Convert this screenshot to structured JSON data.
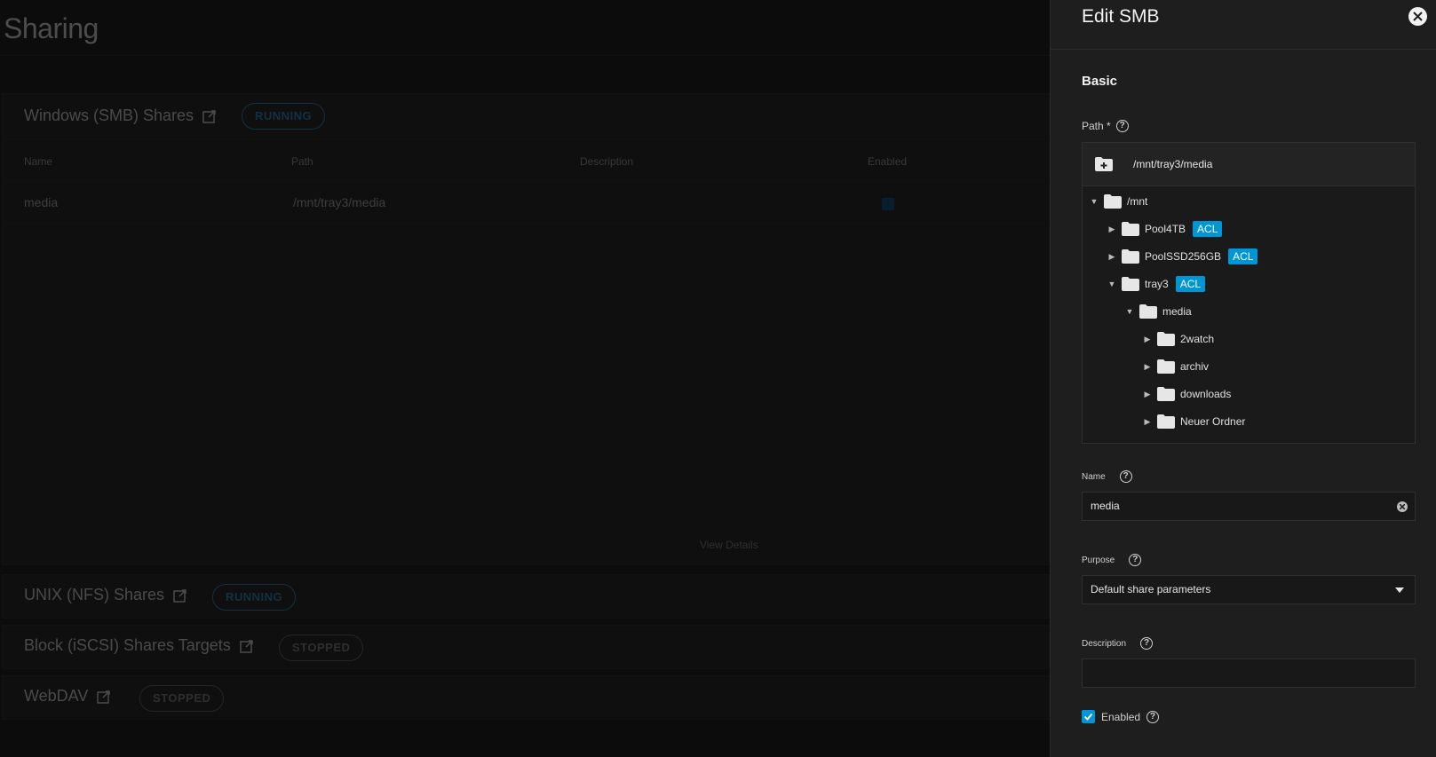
{
  "page": {
    "title": "Sharing"
  },
  "smb_card": {
    "title": "Windows (SMB) Shares",
    "status": "RUNNING",
    "columns": [
      "Name",
      "Path",
      "Description",
      "Enabled"
    ],
    "rows": [
      {
        "name": "media",
        "path": "/mnt/tray3/media",
        "description": "",
        "enabled": true
      }
    ],
    "view_details": "View Details"
  },
  "nfs_card": {
    "title": "UNIX (NFS) Shares",
    "status": "RUNNING"
  },
  "iscsi_card": {
    "title": "Block (iSCSI) Shares Targets",
    "status": "STOPPED"
  },
  "webdav_card": {
    "title": "WebDAV",
    "status": "STOPPED"
  },
  "panel": {
    "title": "Edit SMB",
    "section": "Basic",
    "path_label": "Path *",
    "path_value": "/mnt/tray3/media",
    "tree": [
      {
        "label": "/mnt",
        "level": 0,
        "expanded": true,
        "acl": false
      },
      {
        "label": "Pool4TB",
        "level": 1,
        "expanded": false,
        "acl": true
      },
      {
        "label": "PoolSSD256GB",
        "level": 1,
        "expanded": false,
        "acl": true
      },
      {
        "label": "tray3",
        "level": 1,
        "expanded": true,
        "acl": true
      },
      {
        "label": "media",
        "level": 2,
        "expanded": true,
        "acl": false
      },
      {
        "label": "2watch",
        "level": 3,
        "expanded": false,
        "acl": false
      },
      {
        "label": "archiv",
        "level": 3,
        "expanded": false,
        "acl": false
      },
      {
        "label": "downloads",
        "level": 3,
        "expanded": false,
        "acl": false
      },
      {
        "label": "Neuer Ordner",
        "level": 3,
        "expanded": false,
        "acl": false
      }
    ],
    "acl_badge": "ACL",
    "name_label": "Name",
    "name_value": "media",
    "purpose_label": "Purpose",
    "purpose_value": "Default share parameters",
    "description_label": "Description",
    "description_value": "",
    "enabled_label": "Enabled",
    "enabled": true
  },
  "colors": {
    "accent": "#0095d5",
    "panel_bg": "#1e1e1e"
  }
}
